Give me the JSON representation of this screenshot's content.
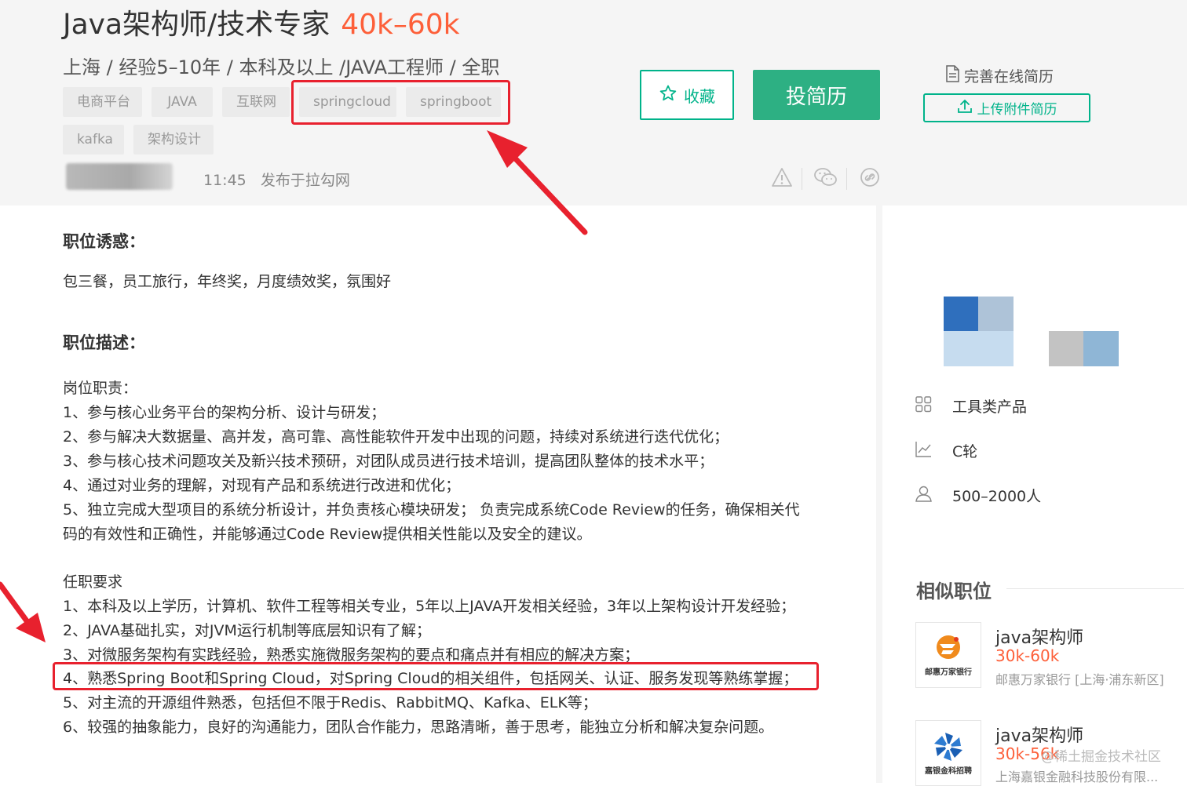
{
  "job": {
    "title": "Java架构师/技术专家",
    "salary": "40k–60k",
    "meta": "上海 / 经验5–10年 / 本科及以上 /JAVA工程师 / 全职",
    "tags": [
      "电商平台",
      "JAVA",
      "互联网",
      "springcloud",
      "springboot",
      "kafka",
      "架构设计"
    ],
    "publish_time": "11:45",
    "publish_source": "发布于拉勾网"
  },
  "actions": {
    "collect_label": "收藏",
    "apply_label": "投简历",
    "perfect_resume_label": "完善在线简历",
    "upload_label": "上传附件简历"
  },
  "icons": {
    "collect": "star-icon",
    "perfect_resume": "document-icon",
    "upload": "upload-icon",
    "report": "warning-icon",
    "wechat": "wechat-icon",
    "link": "link-icon",
    "industry": "grid-icon",
    "stage": "chart-icon",
    "size": "user-icon"
  },
  "content": {
    "perks_title": "职位诱惑：",
    "perks": "包三餐，员工旅行，年终奖，月度绩效奖，氛围好",
    "desc_title": "职位描述：",
    "duties_title": "岗位职责：",
    "duties": [
      "1、参与核心业务平台的架构分析、设计与研发；",
      "2、参与解决大数据量、高并发，高可靠、高性能软件开发中出现的问题，持续对系统进行迭代优化；",
      "3、参与核心技术问题攻关及新兴技术预研，对团队成员进行技术培训，提高团队整体的技术水平；",
      "4、通过对业务的理解，对现有产品和系统进行改进和优化；",
      "5、独立完成大型项目的系统分析设计，并负责核心模块研发； 负责完成系统Code Review的任务，确保相关代",
      "码的有效性和正确性，并能够通过Code Review提供相关性能以及安全的建议。"
    ],
    "requirements_title": "任职要求",
    "requirements": [
      "1、本科及以上学历，计算机、软件工程等相关专业，5年以上JAVA开发相关经验，3年以上架构设计开发经验；",
      "2、JAVA基础扎实，对JVM运行机制等底层知识有了解；",
      "3、对微服务架构有实践经验，熟悉实施微服务架构的要点和痛点并有相应的解决方案；",
      "4、熟悉Spring Boot和Spring Cloud，对Spring Cloud的相关组件，包括网关、认证、服务发现等熟练掌握；",
      "5、对主流的开源组件熟悉，包括但不限于Redis、RabbitMQ、Kafka、ELK等；",
      "6、较强的抽象能力，良好的沟通能力，团队合作能力，思路清晰，善于思考，能独立分析和解决复杂问题。"
    ]
  },
  "company": {
    "industry": "工具类产品",
    "stage": "C轮",
    "size": "500–2000人"
  },
  "similar": {
    "title": "相似职位",
    "items": [
      {
        "title": "java架构师",
        "salary": "30k-60k",
        "company": "邮惠万家银行 [上海·浦东新区]",
        "logo_text": "邮惠万家银行"
      },
      {
        "title": "java架构师",
        "salary": "30k-56k",
        "company": "上海嘉银金融科技股份有限...",
        "logo_text": "嘉银金科招聘"
      }
    ]
  },
  "watermark": "@稀土掘金技术社区",
  "colors": {
    "brand": "#00b38a",
    "salary": "#fd5f39",
    "annotation": "#e8212e"
  }
}
